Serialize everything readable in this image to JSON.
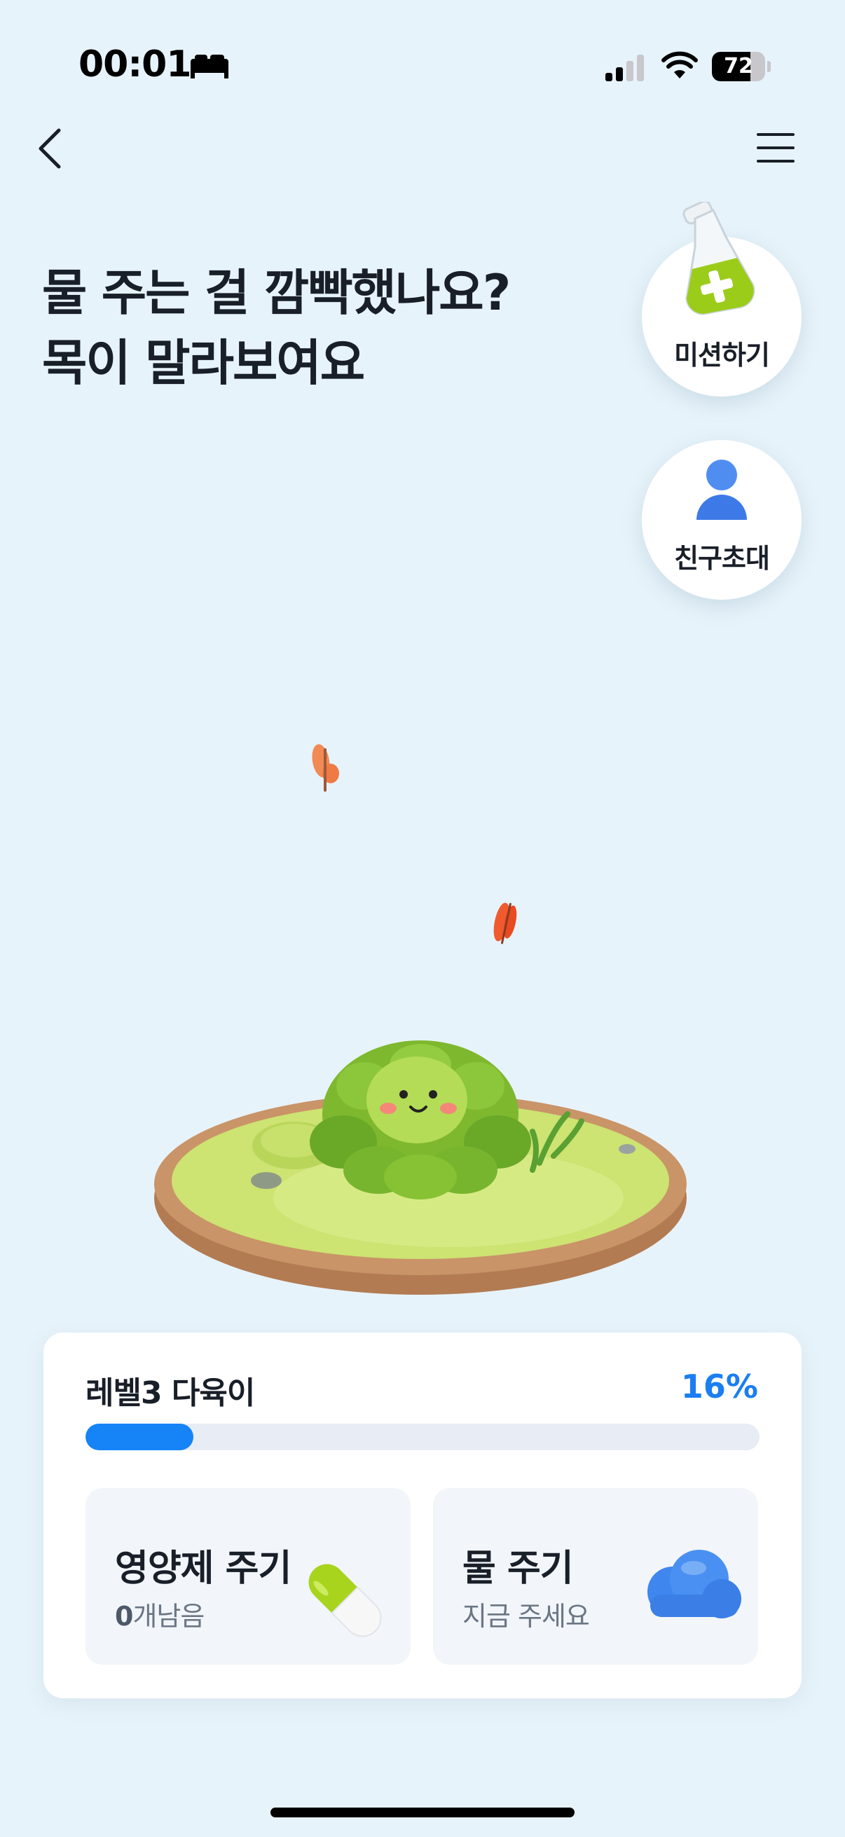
{
  "status_bar": {
    "time": "00:01",
    "battery": "72",
    "battery_level": 0.72
  },
  "headline": {
    "line1": "물 주는 걸 깜빡했나요?",
    "line2": "목이 말라보여요"
  },
  "floating_buttons": {
    "mission": {
      "label": "미션하기",
      "icon": "flask-plus-icon"
    },
    "invite": {
      "label": "친구초대",
      "icon": "person-icon"
    }
  },
  "plant": {
    "title": "레벨3 다육이",
    "progress_label": "16%",
    "progress": 0.16
  },
  "actions": {
    "nutrient": {
      "title": "영양제 주기",
      "count": "0",
      "sub": "개남음",
      "icon": "pill-icon"
    },
    "water": {
      "title": "물 주기",
      "sub": "지금 주세요",
      "icon": "cloud-icon"
    }
  },
  "colors": {
    "accent": "#1683f7",
    "background": "#e7f3fa",
    "plant_green": "#9ccc3a"
  }
}
